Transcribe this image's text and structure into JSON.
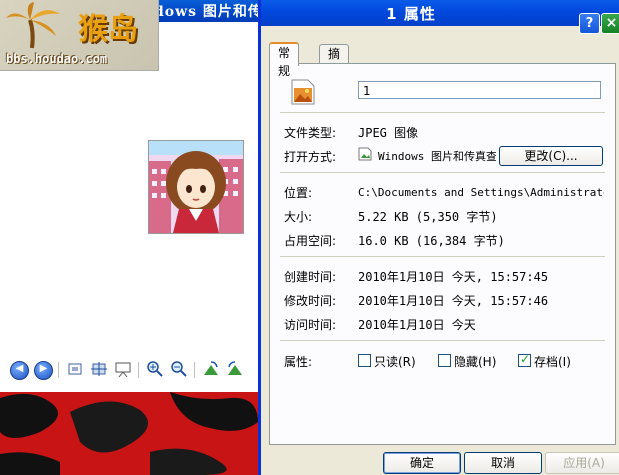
{
  "viewer": {
    "title": "Windows 图片和传真查看器",
    "logo_text": "猴岛",
    "logo_url": "bbs.houdao.com"
  },
  "dialog": {
    "title": "1 属性",
    "help_label": "?",
    "close_label": "×",
    "tabs": [
      {
        "label": "常规",
        "active": true
      },
      {
        "label": "摘要",
        "active": false
      }
    ],
    "file_name": "1",
    "file_type": {
      "label": "文件类型:",
      "value": "JPEG 图像"
    },
    "opens_with": {
      "label": "打开方式:",
      "value": "Windows 图片和传真查看器",
      "change_button": "更改(C)..."
    },
    "location": {
      "label": "位置:",
      "value": "C:\\Documents and Settings\\Administrator\\桌面"
    },
    "size": {
      "label": "大小:",
      "value": "5.22 KB (5,350 字节)"
    },
    "size_on_disk": {
      "label": "占用空间:",
      "value": "16.0 KB (16,384 字节)"
    },
    "created": {
      "label": "创建时间:",
      "value": "2010年1月10日 今天, 15:57:45"
    },
    "modified": {
      "label": "修改时间:",
      "value": "2010年1月10日 今天, 15:57:46"
    },
    "accessed": {
      "label": "访问时间:",
      "value": "2010年1月10日 今天"
    },
    "attributes": {
      "label": "属性:",
      "read_only": {
        "label": "只读(R)",
        "checked": false
      },
      "hidden": {
        "label": "隐藏(H)",
        "checked": false
      },
      "archive": {
        "label": "存档(I)",
        "checked": true
      }
    },
    "buttons": {
      "ok": "确定",
      "cancel": "取消",
      "apply": "应用(A)"
    }
  },
  "colors": {
    "title_blue": "#0248dd",
    "dialog_bg": "#ece9d8",
    "floor_red": "#c81414"
  }
}
